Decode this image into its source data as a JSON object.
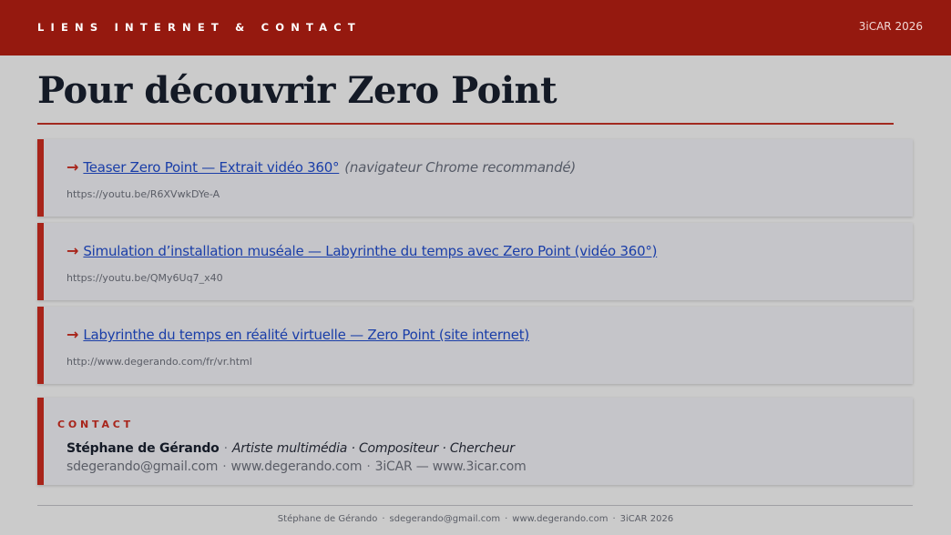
{
  "header": {
    "title": "LIENS INTERNET & CONTACT",
    "tag": "3iCAR 2026"
  },
  "page_title": "Pour découvrir Zero Point",
  "links": [
    {
      "arrow": "→",
      "label": "Teaser Zero Point — Extrait vidéo 360°",
      "note": "(navigateur Chrome recommandé)",
      "url": "https://youtu.be/R6XVwkDYe-A"
    },
    {
      "arrow": "→",
      "label": "Simulation d’installation muséale — Labyrinthe du temps avec Zero Point (vidéo 360°)",
      "url": "https://youtu.be/QMy6Uq7_x40"
    },
    {
      "arrow": "→",
      "label": "Labyrinthe du temps en réalité virtuelle — Zero Point (site internet)",
      "url": "http://www.degerando.com/fr/vr.html"
    }
  ],
  "contact": {
    "label": "CONTACT",
    "name": "Stéphane de Gérando",
    "role": "Artiste multimédia · Compositeur · Chercheur",
    "email": "sdegerando@gmail.com",
    "website": "www.degerando.com",
    "org": "3iCAR — www.3icar.com",
    "separator": "·"
  },
  "footer": {
    "name": "Stéphane de Gérando",
    "email": "sdegerando@gmail.com",
    "website": "www.degerando.com",
    "tag": "3iCAR 2026",
    "separator": "·"
  },
  "colors": {
    "header_bg": "#95190f",
    "accent": "#a8241a",
    "link": "#1a3ea8",
    "page_bg": "#cbcbcb"
  }
}
